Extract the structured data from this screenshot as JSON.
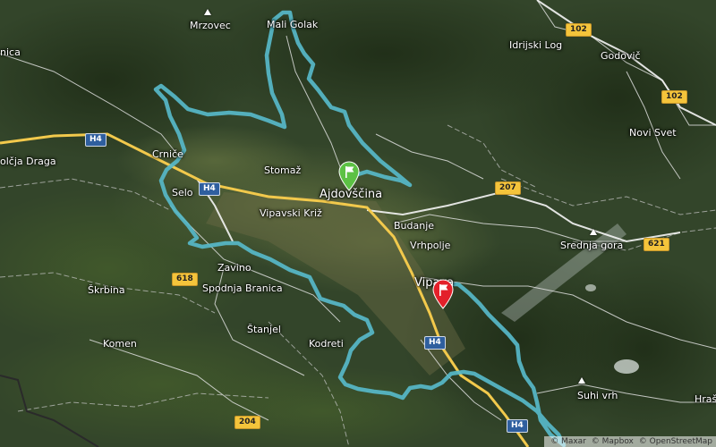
{
  "map": {
    "colors": {
      "route": "#57b9c9",
      "start_marker": "#5cc144",
      "end_marker": "#e3202a",
      "highway": "#f2c94c",
      "road": "#e8e8e8"
    },
    "places": {
      "mali_golak": "Mali Golak",
      "mrzovec": "Mrzovec",
      "idrijski_log": "Idrijski Log",
      "godovic": "Godovič",
      "novi_svet": "Novi Svet",
      "crnice": "Crniče",
      "stomaz": "Stomaž",
      "ajdovscina": "Ajdovščina",
      "selo": "Selo",
      "vipavski_kriz": "Vipavski Križ",
      "budanje": "Budanje",
      "vrhpolje": "Vrhpolje",
      "srednja_gora": "Srednja gora",
      "zavino": "Zavino",
      "spodnja_branica": "Spodnja Branica",
      "skrbina": "Škrbina",
      "vipava": "Vipava",
      "stanjel": "Štanjel",
      "komen": "Komen",
      "kodreti": "Kodreti",
      "suhi_vrh": "Suhi vrh",
      "hrase": "Hraš",
      "branica_edge": "nica",
      "dolcja_draga": "olčja Draga"
    },
    "roads": {
      "h4_a": "H4",
      "h4_b": "H4",
      "h4_c": "H4",
      "h4_d": "H4",
      "r102_a": "102",
      "r102_b": "102",
      "r207": "207",
      "r621": "621",
      "r618": "618",
      "r204": "204"
    },
    "markers": {
      "start": "start-flag-icon",
      "end": "finish-flag-icon"
    },
    "attribution": {
      "maxar": "© Maxar",
      "mapbox": "© Mapbox",
      "osm": "© OpenStreetMap"
    }
  }
}
